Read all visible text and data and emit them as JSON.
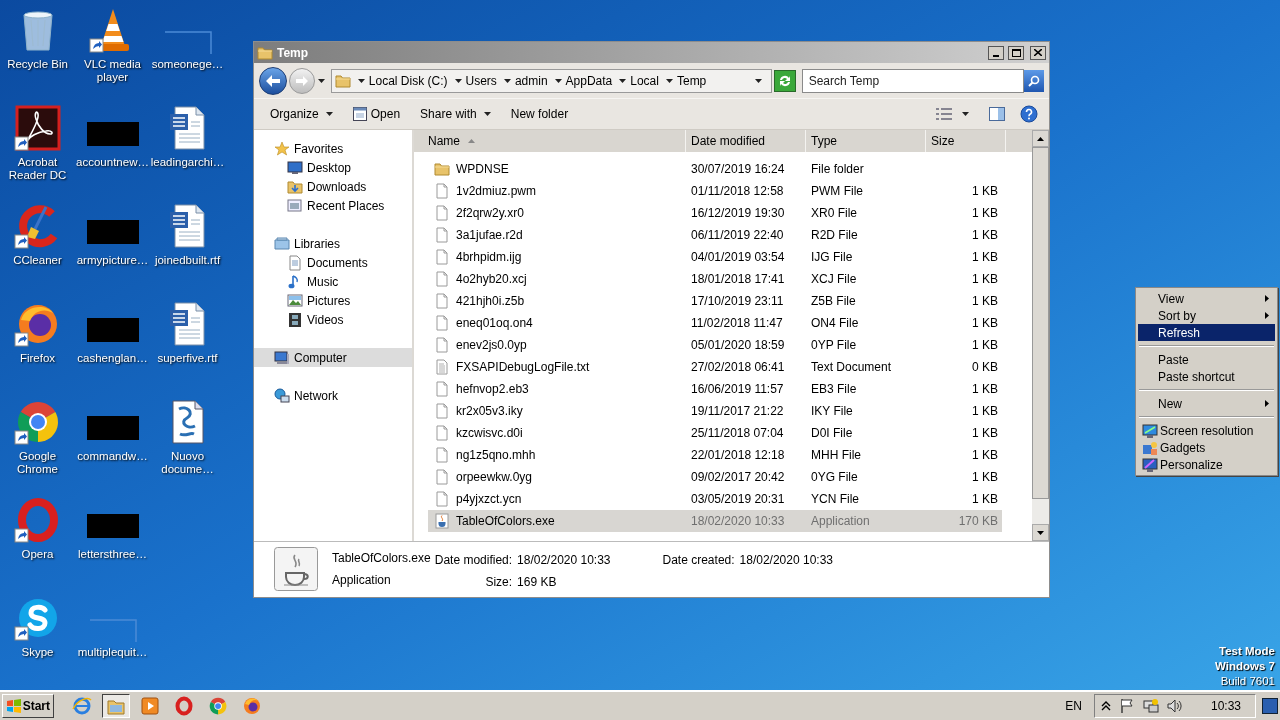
{
  "desktop": {
    "icons": [
      {
        "label": "Recycle Bin",
        "kind": "recycle",
        "shortcut": false
      },
      {
        "label": "Acrobat Reader DC",
        "kind": "acrobat",
        "shortcut": true
      },
      {
        "label": "CCleaner",
        "kind": "ccleaner",
        "shortcut": true
      },
      {
        "label": "Firefox",
        "kind": "firefox",
        "shortcut": true
      },
      {
        "label": "Google Chrome",
        "kind": "chrome",
        "shortcut": true
      },
      {
        "label": "Opera",
        "kind": "opera",
        "shortcut": true
      },
      {
        "label": "Skype",
        "kind": "skype",
        "shortcut": true
      },
      {
        "label": "VLC media player",
        "kind": "vlc",
        "shortcut": true
      },
      {
        "label": "accountnew…",
        "kind": "thumbnail",
        "shortcut": false
      },
      {
        "label": "armypicture…",
        "kind": "thumbnail",
        "shortcut": false
      },
      {
        "label": "cashenglan…",
        "kind": "thumbnail",
        "shortcut": false
      },
      {
        "label": "commandw…",
        "kind": "thumbnail",
        "shortcut": false
      },
      {
        "label": "lettersthree…",
        "kind": "thumbnail",
        "shortcut": false
      },
      {
        "label": "multiplequit…",
        "kind": "blank",
        "shortcut": false
      },
      {
        "label": "someonege…",
        "kind": "blank",
        "shortcut": false
      },
      {
        "label": "leadingarchi…",
        "kind": "word",
        "shortcut": false
      },
      {
        "label": "joinedbuilt.rtf",
        "kind": "word",
        "shortcut": false
      },
      {
        "label": "superfive.rtf",
        "kind": "word",
        "shortcut": false
      },
      {
        "label": "Nuovo docume…",
        "kind": "script",
        "shortcut": false
      }
    ],
    "notice": [
      {
        "text": "Test Mode",
        "bold": true
      },
      {
        "text": "Windows 7",
        "bold": true
      },
      {
        "text": "Build 7601",
        "bold": false
      }
    ]
  },
  "explorer": {
    "title": "Temp",
    "breadcrumbs": [
      "Local Disk (C:)",
      "Users",
      "admin",
      "AppData",
      "Local",
      "Temp"
    ],
    "search": {
      "placeholder": "Search Temp"
    },
    "toolbar": [
      {
        "label": "Organize",
        "kind": "menu"
      },
      {
        "label": "Open",
        "kind": "open"
      },
      {
        "label": "Share with",
        "kind": "menu"
      },
      {
        "label": "New folder",
        "kind": "plain"
      }
    ],
    "nav": [
      {
        "label": "Favorites",
        "kind": "star",
        "selected": false,
        "children": [
          {
            "label": "Desktop",
            "kind": "desktop",
            "selected": false
          },
          {
            "label": "Downloads",
            "kind": "downloads",
            "selected": false
          },
          {
            "label": "Recent Places",
            "kind": "recent",
            "selected": false
          }
        ]
      },
      {
        "label": "Libraries",
        "kind": "libraries",
        "selected": false,
        "children": [
          {
            "label": "Documents",
            "kind": "documents",
            "selected": false
          },
          {
            "label": "Music",
            "kind": "music",
            "selected": false
          },
          {
            "label": "Pictures",
            "kind": "pictures",
            "selected": false
          },
          {
            "label": "Videos",
            "kind": "videos",
            "selected": false
          }
        ]
      },
      {
        "label": "Computer",
        "kind": "computer",
        "selected": true
      },
      {
        "label": "Network",
        "kind": "network",
        "selected": false
      }
    ],
    "columns": [
      {
        "label": "Name",
        "sorted": true
      },
      {
        "label": "Date modified",
        "sorted": false
      },
      {
        "label": "Type",
        "sorted": false
      },
      {
        "label": "Size",
        "sorted": false
      }
    ],
    "rows": [
      {
        "name": "WPDNSE",
        "date": "30/07/2019 16:24",
        "type": "File folder",
        "kind": "folder",
        "selected": false
      },
      {
        "name": "1v2dmiuz.pwm",
        "date": "01/11/2018 12:58",
        "type": "PWM File",
        "size": "1 KB",
        "kind": "file",
        "selected": false
      },
      {
        "name": "2f2qrw2y.xr0",
        "date": "16/12/2019 19:30",
        "type": "XR0 File",
        "size": "1 KB",
        "kind": "file",
        "selected": false
      },
      {
        "name": "3a1jufae.r2d",
        "date": "06/11/2019 22:40",
        "type": "R2D File",
        "size": "1 KB",
        "kind": "file",
        "selected": false
      },
      {
        "name": "4brhpidm.ijg",
        "date": "04/01/2019 03:54",
        "type": "IJG File",
        "size": "1 KB",
        "kind": "file",
        "selected": false
      },
      {
        "name": "4o2hyb20.xcj",
        "date": "18/01/2018 17:41",
        "type": "XCJ File",
        "size": "1 KB",
        "kind": "file",
        "selected": false
      },
      {
        "name": "421hjh0i.z5b",
        "date": "17/10/2019 23:11",
        "type": "Z5B File",
        "size": "1 KB",
        "kind": "file",
        "selected": false
      },
      {
        "name": "eneq01oq.on4",
        "date": "11/02/2018 11:47",
        "type": "ON4 File",
        "size": "1 KB",
        "kind": "file",
        "selected": false
      },
      {
        "name": "enev2js0.0yp",
        "date": "05/01/2020 18:59",
        "type": "0YP File",
        "size": "1 KB",
        "kind": "file",
        "selected": false
      },
      {
        "name": "FXSAPIDebugLogFile.txt",
        "date": "27/02/2018 06:41",
        "type": "Text Document",
        "size": "0 KB",
        "kind": "text",
        "selected": false
      },
      {
        "name": "hefnvop2.eb3",
        "date": "16/06/2019 11:57",
        "type": "EB3 File",
        "size": "1 KB",
        "kind": "file",
        "selected": false
      },
      {
        "name": "kr2x05v3.iky",
        "date": "19/11/2017 21:22",
        "type": "IKY File",
        "size": "1 KB",
        "kind": "file",
        "selected": false
      },
      {
        "name": "kzcwisvc.d0i",
        "date": "25/11/2018 07:04",
        "type": "D0I File",
        "size": "1 KB",
        "kind": "file",
        "selected": false
      },
      {
        "name": "ng1z5qno.mhh",
        "date": "22/01/2018 12:18",
        "type": "MHH File",
        "size": "1 KB",
        "kind": "file",
        "selected": false
      },
      {
        "name": "orpeewkw.0yg",
        "date": "09/02/2017 20:42",
        "type": "0YG File",
        "size": "1 KB",
        "kind": "file",
        "selected": false
      },
      {
        "name": "p4yjxzct.ycn",
        "date": "03/05/2019 20:31",
        "type": "YCN File",
        "size": "1 KB",
        "kind": "file",
        "selected": false
      },
      {
        "name": "TableOfColors.exe",
        "date": "18/02/2020 10:33",
        "type": "Application",
        "size": "170 KB",
        "kind": "app",
        "selected": true
      }
    ],
    "details": {
      "name": "TableOfColors.exe",
      "type": "Application",
      "field_columns": [
        [
          {
            "label": "Date modified:",
            "value": "18/02/2020 10:33"
          },
          {
            "label": "Size:",
            "value": "169 KB"
          }
        ],
        [
          {
            "label": "Date created:",
            "value": "18/02/2020 10:33"
          }
        ]
      ]
    }
  },
  "context_menu": {
    "groups": [
      [
        {
          "label": "View",
          "kind": "plain",
          "submenu": true,
          "selected": false
        },
        {
          "label": "Sort by",
          "kind": "plain",
          "submenu": true,
          "selected": false
        },
        {
          "label": "Refresh",
          "kind": "plain",
          "submenu": false,
          "selected": true
        }
      ],
      [
        {
          "label": "Paste",
          "kind": "plain",
          "submenu": false,
          "selected": false
        },
        {
          "label": "Paste shortcut",
          "kind": "plain",
          "submenu": false,
          "selected": false
        }
      ],
      [
        {
          "label": "New",
          "kind": "plain",
          "submenu": true,
          "selected": false
        }
      ],
      [
        {
          "label": "Screen resolution",
          "kind": "display",
          "submenu": false,
          "selected": false
        },
        {
          "label": "Gadgets",
          "kind": "gadgets",
          "submenu": false,
          "selected": false
        },
        {
          "label": "Personalize",
          "kind": "personalize",
          "submenu": false,
          "selected": false
        }
      ]
    ]
  },
  "taskbar": {
    "start": "Start",
    "apps": [
      {
        "kind": "ie",
        "active": false
      },
      {
        "kind": "explorer",
        "active": true
      },
      {
        "kind": "media",
        "active": false
      },
      {
        "kind": "opera",
        "active": false
      },
      {
        "kind": "chrome",
        "active": false
      },
      {
        "kind": "firefox",
        "active": false
      }
    ],
    "language": "EN",
    "clock": "10:33"
  }
}
